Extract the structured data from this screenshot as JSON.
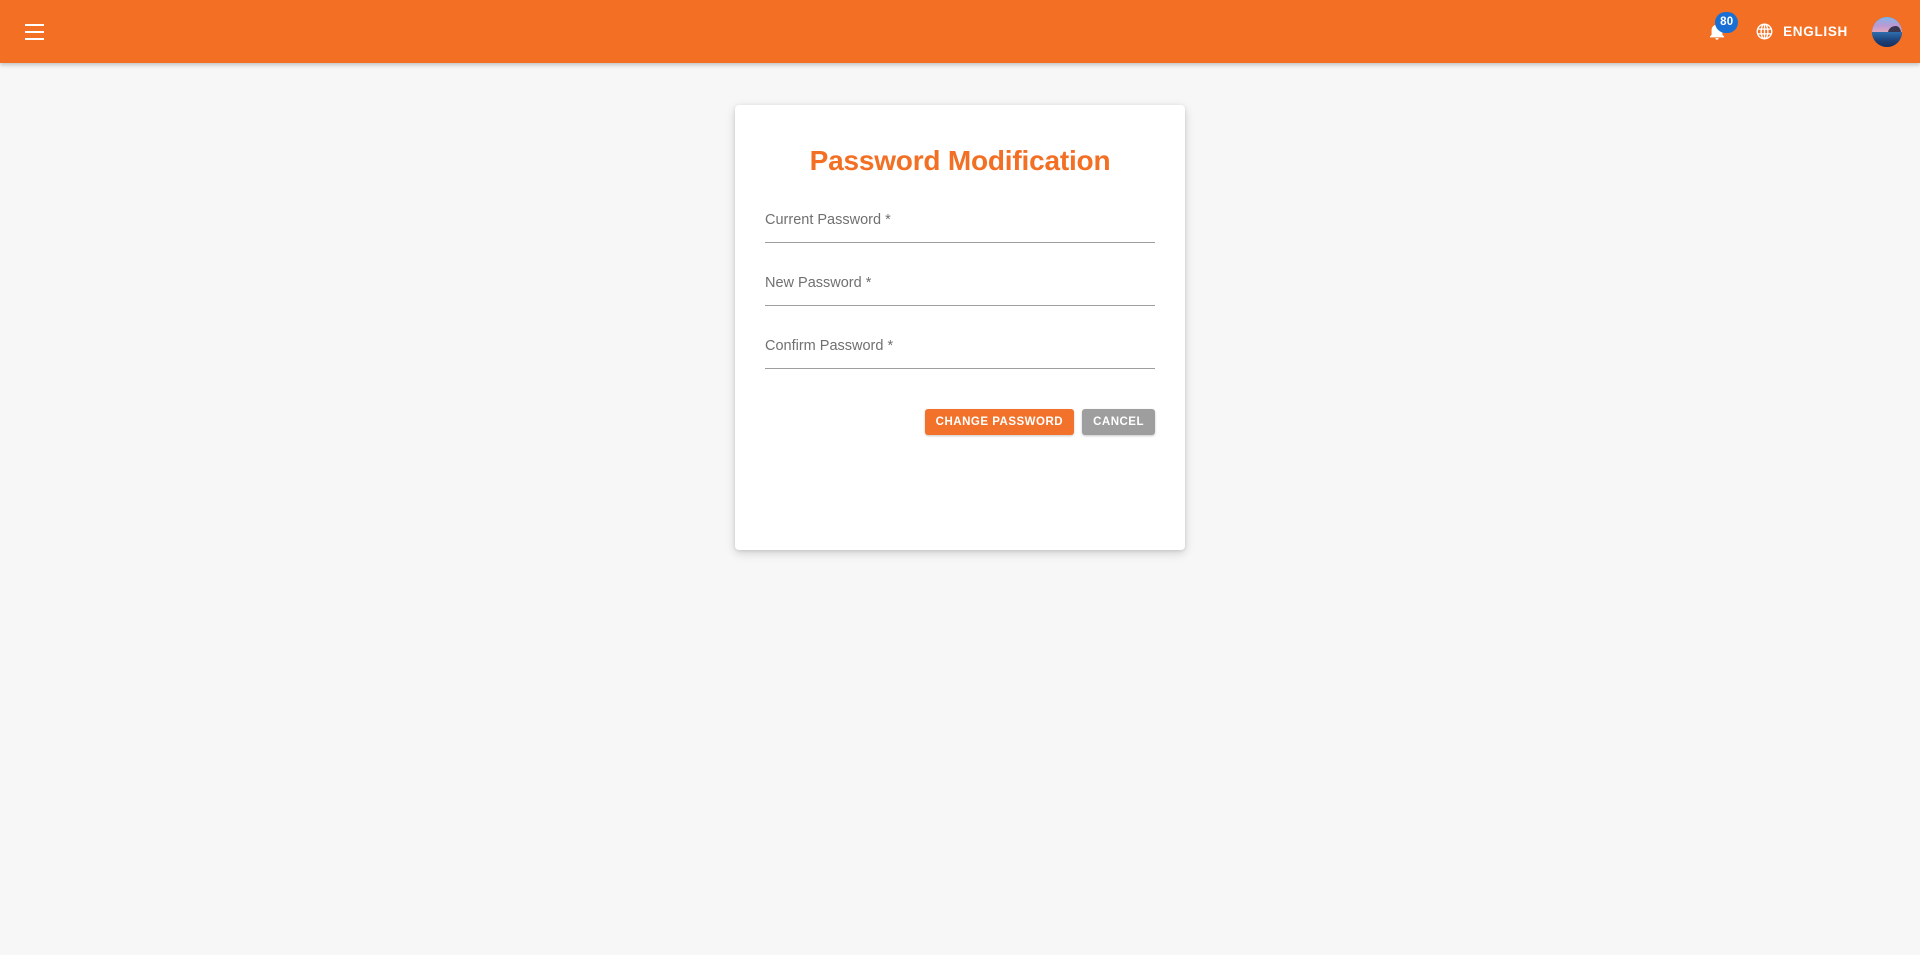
{
  "topbar": {
    "menu_icon": "hamburger-menu-icon",
    "notifications": {
      "icon": "bell-icon",
      "badge_count": "80",
      "badge_color": "#1a6fd4"
    },
    "language": {
      "icon": "globe-icon",
      "label": "ENGLISH"
    },
    "avatar": {
      "icon": "user-avatar"
    },
    "background_color": "#f26f23"
  },
  "card": {
    "title": "Password Modification",
    "title_color": "#f26f23",
    "fields": [
      {
        "name": "current-password",
        "placeholder": "Current Password *",
        "value": "",
        "type": "password"
      },
      {
        "name": "new-password",
        "placeholder": "New Password *",
        "value": "",
        "type": "password"
      },
      {
        "name": "confirm-password",
        "placeholder": "Confirm Password *",
        "value": "",
        "type": "password"
      }
    ],
    "buttons": {
      "submit_label": "CHANGE PASSWORD",
      "submit_color": "#f2722b",
      "cancel_label": "CANCEL",
      "cancel_color": "#9e9e9e"
    }
  },
  "page": {
    "background_color": "#f7f7f7"
  }
}
